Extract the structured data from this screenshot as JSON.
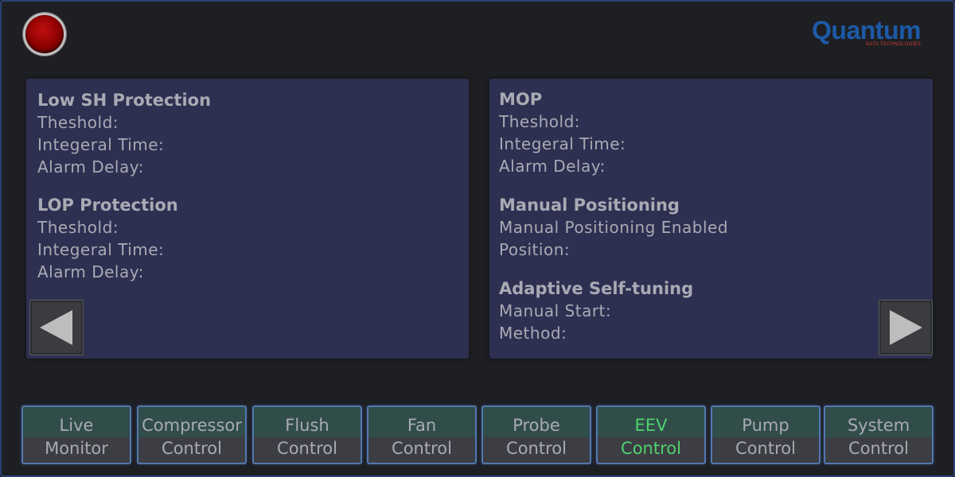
{
  "brand": {
    "logo_text": "Quantum",
    "logo_subtext": "DATA TECHNOLOGIES"
  },
  "left_panel": {
    "sections": [
      {
        "title": "Low SH Protection",
        "fields": [
          "Theshold:",
          "Integeral Time:",
          "Alarm Delay:"
        ]
      },
      {
        "title": "LOP Protection",
        "fields": [
          "Theshold:",
          "Integeral Time:",
          "Alarm Delay:"
        ]
      }
    ]
  },
  "right_panel": {
    "sections": [
      {
        "title": "MOP",
        "fields": [
          "Theshold:",
          "Integeral Time:",
          "Alarm Delay:"
        ]
      },
      {
        "title": "Manual Positioning",
        "fields": [
          "Manual Positioning Enabled",
          "Position:"
        ]
      },
      {
        "title": "Adaptive Self-tuning",
        "fields": [
          "Manual Start:",
          "Method:"
        ]
      }
    ]
  },
  "tabs": [
    {
      "line1": "Live",
      "line2": "Monitor",
      "active": false
    },
    {
      "line1": "Compressor",
      "line2": "Control",
      "active": false
    },
    {
      "line1": "Flush",
      "line2": "Control",
      "active": false
    },
    {
      "line1": "Fan",
      "line2": "Control",
      "active": false
    },
    {
      "line1": "Probe",
      "line2": "Control",
      "active": false
    },
    {
      "line1": "EEV",
      "line2": "Control",
      "active": true
    },
    {
      "line1": "Pump",
      "line2": "Control",
      "active": false
    },
    {
      "line1": "System",
      "line2": "Control",
      "active": false
    }
  ],
  "colors": {
    "active_tab_text": "#4ed36b",
    "status_light": "#c11010",
    "panel_bg": "#2e3052"
  },
  "icons": {
    "status": "red-indicator-light",
    "prev": "triangle-left-icon",
    "next": "triangle-right-icon"
  }
}
